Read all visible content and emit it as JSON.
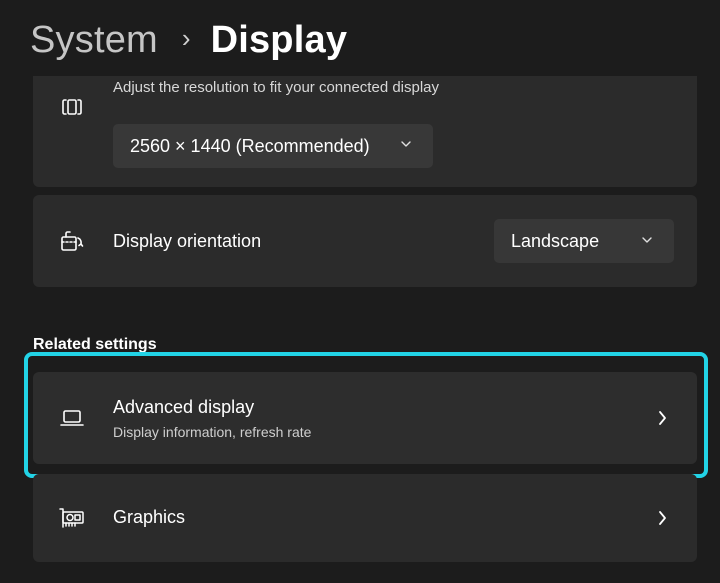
{
  "breadcrumb": {
    "parent": "System",
    "separator": "›",
    "current": "Display"
  },
  "resolution": {
    "icon": "resolution-icon",
    "description": "Adjust the resolution to fit your connected display",
    "selected": "2560 × 1440 (Recommended)"
  },
  "orientation": {
    "icon": "orientation-icon",
    "label": "Display orientation",
    "selected": "Landscape"
  },
  "related_settings": {
    "heading": "Related settings",
    "items": [
      {
        "icon": "laptop-icon",
        "title": "Advanced display",
        "subtitle": "Display information, refresh rate",
        "highlighted": true
      },
      {
        "icon": "graphics-card-icon",
        "title": "Graphics"
      }
    ]
  },
  "colors": {
    "background": "#1c1c1c",
    "card": "#2b2b2b",
    "dropdown": "#383838",
    "highlight_border": "#22d3e6"
  }
}
